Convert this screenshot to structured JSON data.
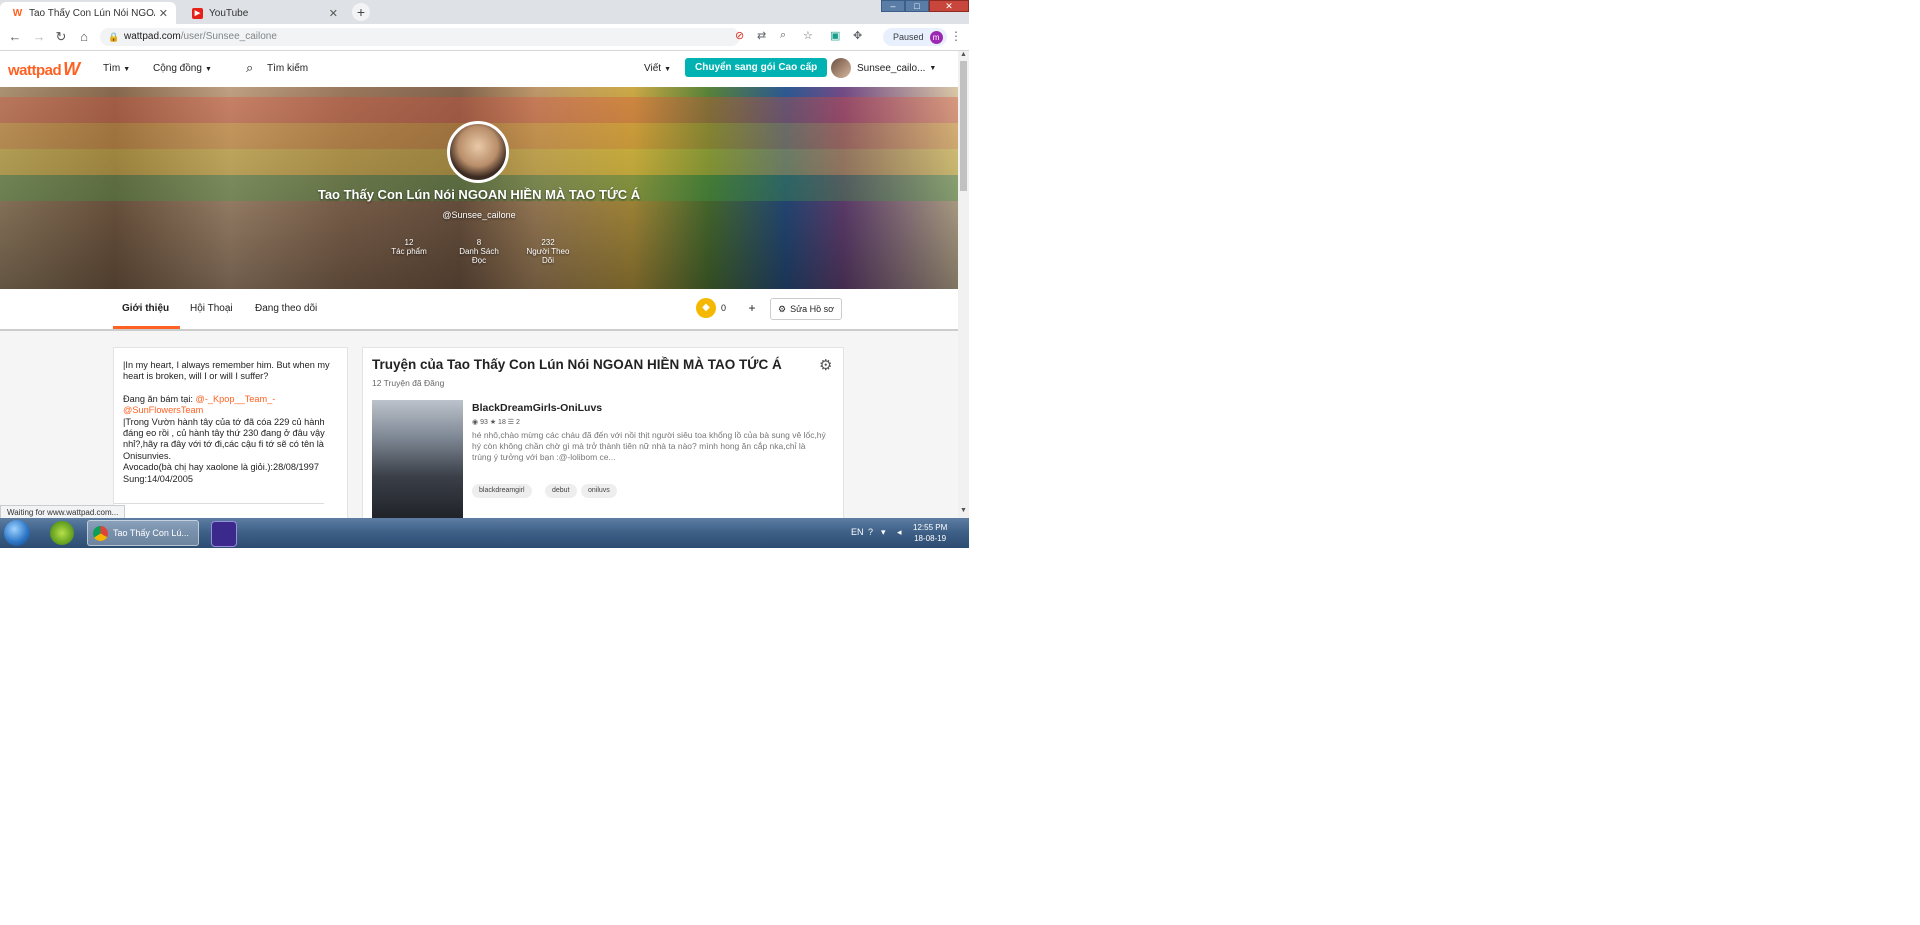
{
  "browser": {
    "tabs": [
      {
        "title": "Tao Thấy Con Lún Nói NGOAN H",
        "favicon": "W"
      },
      {
        "title": "YouTube",
        "favicon": "▶"
      }
    ],
    "url_host": "wattpad.com",
    "url_path": "/user/Sunsee_cailone",
    "profile_status": "Paused",
    "profile_initial": "m"
  },
  "header": {
    "logo": "wattpad",
    "nav_find": "Tìm",
    "nav_community": "Cộng đồng",
    "search_placeholder": "Tìm kiếm",
    "write": "Viết",
    "premium_button": "Chuyển sang gói Cao cấp",
    "username": "Sunsee_cailo..."
  },
  "profile": {
    "name": "Tao Thấy Con Lún Nói NGOAN HIỀN MÀ TAO TỨC Á",
    "handle": "@Sunsee_cailone",
    "stats": [
      {
        "value": "12",
        "label_1": "Tác phẩm",
        "label_2": ""
      },
      {
        "value": "8",
        "label_1": "Danh Sách",
        "label_2": "Đọc"
      },
      {
        "value": "232",
        "label_1": "Người Theo",
        "label_2": "Dõi"
      }
    ]
  },
  "tabs": {
    "about": "Giới thiệu",
    "conversations": "Hội Thoại",
    "following": "Đang theo dõi",
    "coins": "0",
    "plus": "+",
    "edit_profile": "Sửa Hồ sơ"
  },
  "about": {
    "p1": "|In my heart, I always remember him. But when my heart is broken, will I or will I suffer?",
    "p2_prefix": "Đang ăn bám tại: ",
    "p2_link1": "@-_Kpop__Team_-",
    "p2_link2": "@SunFlowersTeam",
    "p3": "|Trong Vườn hành tây của tớ đã cóa 229 củ hành đáng eo rồi , củ hành tây  thứ 230 đang ở đâu vậy nhỉ?,hãy ra đây với tớ đi,các cậu fi tớ sẽ có tên là Onisunvies.",
    "p4": "Avocado(bà chị hay xaolone là giỏi.):28/08/1997",
    "p5": "Sung:14/04/2005"
  },
  "stories": {
    "title": "Truyện của Tao Thấy Con Lún Nói NGOAN HIỀN MÀ TAO TỨC Á",
    "subtitle": "12 Truyện đã Đăng",
    "book": {
      "title": "BlackDreamGirls-OniLuvs",
      "reads": "93",
      "votes": "18",
      "parts": "2",
      "description": "hé nhô,chào mừng các cháu đã đến với nồi thịt người siêu toa khổng lồ của bà sung vê lốc,hý hý còn không chần chờ gì mà trở thành tiên nữ nhà ta nào? mình hong ăn cắp nka,chỉ là trùng ý tưởng với bạn :@-lolibom ce...",
      "tags": [
        "blackdreamgirl",
        "debut",
        "oniluvs"
      ]
    }
  },
  "status_bar": "Waiting for www.wattpad.com...",
  "taskbar": {
    "chrome_label": "Tao Thấy Con Lú...",
    "language": "EN",
    "time": "12:55 PM",
    "date": "18-08-19"
  }
}
